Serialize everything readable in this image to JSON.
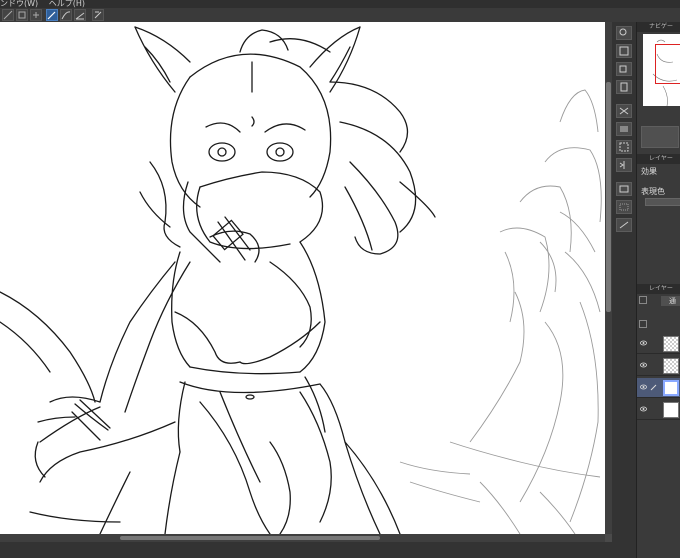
{
  "menubar": {
    "items": [
      "ンドウ(W)",
      "ヘルプ(H)"
    ]
  },
  "navigator": {
    "title": "ナビゲー"
  },
  "layer_property": {
    "title": "レイヤー",
    "effect_label": "効果",
    "display_color_label": "表現色"
  },
  "layers_panel": {
    "title": "レイヤー",
    "blend_mode": "通",
    "layers": [
      {
        "visible": true,
        "selected": false,
        "thumb": "checker"
      },
      {
        "visible": true,
        "selected": false,
        "thumb": "checker"
      },
      {
        "visible": true,
        "selected": true,
        "thumb": "white"
      },
      {
        "visible": true,
        "selected": false,
        "thumb": "white"
      }
    ]
  },
  "colors": {
    "accent": "#2f5f9a",
    "selection": "#4d5a78",
    "nav_frame": "#dd2222"
  }
}
